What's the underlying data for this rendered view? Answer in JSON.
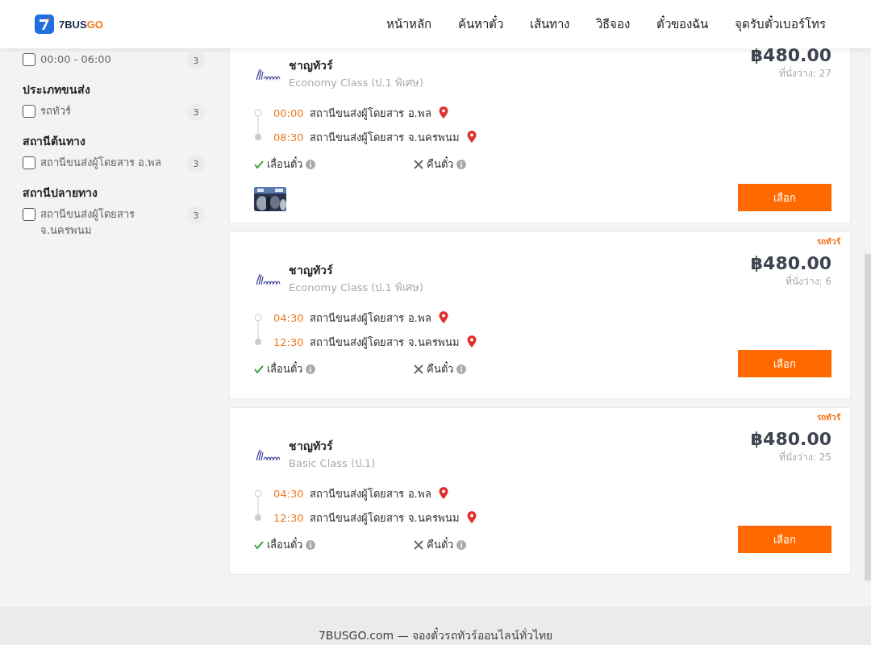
{
  "header": {
    "logo": {
      "prefix": "7BUS",
      "suffix": "GO"
    },
    "nav": [
      {
        "label": "หน้าหลัก"
      },
      {
        "label": "ค้นหาตั๋ว"
      },
      {
        "label": "เส้นทาง"
      },
      {
        "label": "วิธีจอง"
      },
      {
        "label": "ตั๋วของฉัน"
      },
      {
        "label": "จุดรับตั๋วเบอร์โทร"
      }
    ]
  },
  "filters": [
    {
      "options": [
        {
          "label": "00:00 - 06:00",
          "count": "3",
          "checked": false
        }
      ]
    },
    {
      "title": "ประเภทขนส่ง",
      "options": [
        {
          "label": "รถทัวร์",
          "count": "3",
          "checked": false
        }
      ]
    },
    {
      "title": "สถานีต้นทาง",
      "options": [
        {
          "label": "สถานีขนส่งผู้โดยสาร อ.พล",
          "count": "3",
          "checked": false
        }
      ]
    },
    {
      "title": "สถานีปลายทาง",
      "options": [
        {
          "label": "สถานีขนส่งผู้โดยสาร จ.นครพนม",
          "count": "3",
          "checked": false
        }
      ]
    }
  ],
  "trips": [
    {
      "operator": "ชาญทัวร์",
      "class": "Economy Class (ป.1 พิเศษ)",
      "price": "฿480.00",
      "seats": "ที่นั่งว่าง: 27",
      "stops": [
        {
          "time": "00:00",
          "station": "สถานีขนส่งผู้โดยสาร อ.พล"
        },
        {
          "time": "08:30",
          "station": "สถานีขนส่งผู้โดยสาร จ.นครพนม"
        }
      ],
      "features": [
        {
          "label": "เลื่อนตั๋ว",
          "allowed": true
        },
        {
          "label": "คืนตั๋ว",
          "allowed": false
        }
      ],
      "photos": [
        {
          "kind": "picture"
        }
      ],
      "button": "เลือก"
    },
    {
      "tag": "รถทัวร์",
      "operator": "ชาญทัวร์",
      "class": "Economy Class (ป.1 พิเศษ)",
      "price": "฿480.00",
      "seats": "ที่นั่งว่าง: 6",
      "stops": [
        {
          "time": "04:30",
          "station": "สถานีขนส่งผู้โดยสาร อ.พล"
        },
        {
          "time": "12:30",
          "station": "สถานีขนส่งผู้โดยสาร จ.นครพนม"
        }
      ],
      "features": [
        {
          "label": "เลื่อนตั๋ว",
          "allowed": true
        },
        {
          "label": "คืนตั๋ว",
          "allowed": false
        }
      ],
      "button": "เลือก"
    },
    {
      "tag": "รถทัวร์",
      "operator": "ชาญทัวร์",
      "class": "Basic Class (ป.1)",
      "price": "฿480.00",
      "seats": "ที่นั่งว่าง: 25",
      "stops": [
        {
          "time": "04:30",
          "station": "สถานีขนส่งผู้โดยสาร อ.พล"
        },
        {
          "time": "12:30",
          "station": "สถานีขนส่งผู้โดยสาร จ.นครพนม"
        }
      ],
      "features": [
        {
          "label": "เลื่อนตั๋ว",
          "allowed": true
        },
        {
          "label": "คืนตั๋ว",
          "allowed": false
        }
      ],
      "button": "เลือก"
    }
  ],
  "footer": {
    "text": "7BUSGO.com — จองตั๋วรถทัวร์ออนไลน์ทั่วไทย"
  }
}
